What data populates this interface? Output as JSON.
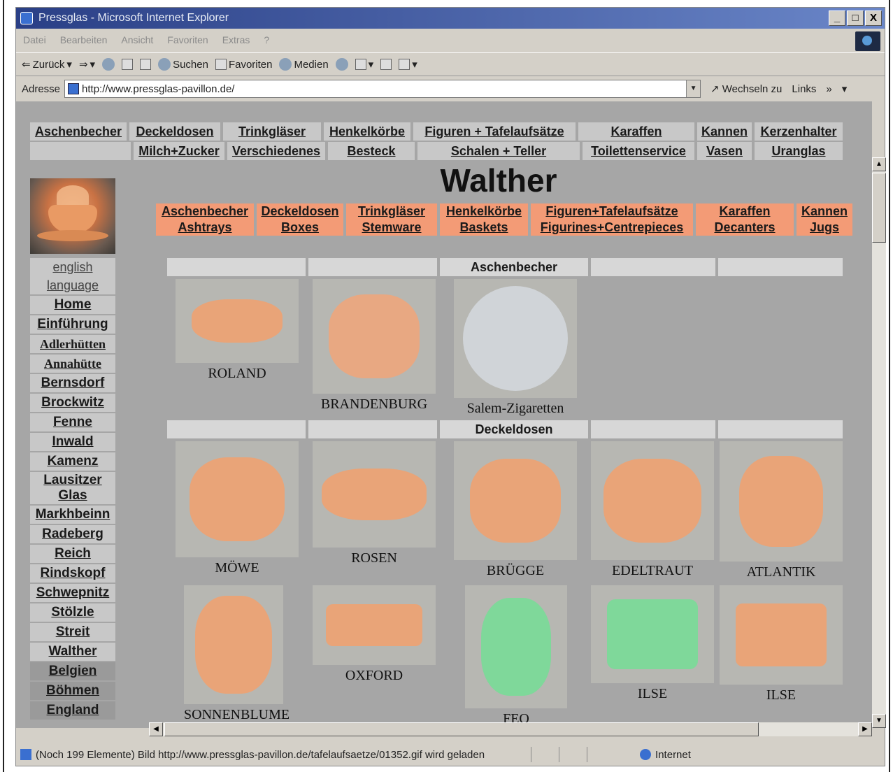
{
  "window": {
    "title": "Pressglas - Microsoft Internet Explorer",
    "minimize": "_",
    "maximize": "□",
    "close": "X"
  },
  "menu": [
    "Datei",
    "Bearbeiten",
    "Ansicht",
    "Favoriten",
    "Extras",
    "?"
  ],
  "toolbar": {
    "back": "Zurück",
    "search": "Suchen",
    "favorites": "Favoriten",
    "media": "Medien"
  },
  "address": {
    "label": "Adresse",
    "url": "http://www.pressglas-pavillon.de/",
    "go": "Wechseln zu",
    "links": "Links"
  },
  "status": {
    "text": "(Noch 199 Elemente) Bild http://www.pressglas-pavillon.de/tafelaufsaetze/01352.gif wird geladen",
    "zone": "Internet"
  },
  "topnav": {
    "row1": [
      "Aschenbecher",
      "Deckeldosen",
      "Trinkgläser",
      "Henkelkörbe",
      "Figuren + Tafelaufsätze",
      "Karaffen",
      "Kannen",
      "Kerzenhalter"
    ],
    "row2": [
      "Milch+Zucker",
      "Verschiedenes",
      "Besteck",
      "Schalen + Teller",
      "Toilettenservice",
      "Vasen",
      "Uranglas"
    ]
  },
  "sidebar": {
    "english": "english",
    "language": "language",
    "items": [
      "Home",
      "Einführung",
      "Adlerhütten",
      "Annahütte",
      "Bernsdorf",
      "Brockwitz",
      "Fenne",
      "Inwald",
      "Kamenz",
      "Lausitzer Glas",
      "Markhbeinn",
      "Radeberg",
      "Reich",
      "Rindskopf",
      "Schwepnitz",
      "Stölzle",
      "Streit",
      "Walther"
    ],
    "country_items": [
      "Belgien",
      "Böhmen",
      "England"
    ]
  },
  "page_title": "Walther",
  "orange_nav": [
    {
      "de": "Aschenbecher",
      "en": "Ashtrays"
    },
    {
      "de": "Deckeldosen",
      "en": "Boxes"
    },
    {
      "de": "Trinkgläser",
      "en": "Stemware"
    },
    {
      "de": "Henkelkörbe",
      "en": "Baskets"
    },
    {
      "de": "Figuren+Tafelaufsätze",
      "en": "Figurines+Centrepieces"
    },
    {
      "de": "Karaffen",
      "en": "Decanters"
    },
    {
      "de": "Kannen",
      "en": "Jugs"
    }
  ],
  "sections": {
    "ashtrays": "Aschenbecher",
    "boxes": "Deckeldosen"
  },
  "ashtrays": [
    "ROLAND",
    "BRANDENBURG",
    "Salem-Zigaretten"
  ],
  "boxes_row1": [
    "MÖWE",
    "ROSEN",
    "BRÜGGE",
    "EDELTRAUT",
    "ATLANTIK"
  ],
  "boxes_row2": [
    "SONNENBLUME",
    "OXFORD",
    "FEO",
    "ILSE",
    "ILSE"
  ],
  "colors": {
    "content_bg": "#a6a6a6",
    "orange_nav": "#f39b76",
    "nav_cell": "#c8c8c8",
    "pink_glass": "#e9a478",
    "green_glass": "#7fd89a",
    "clear_glass": "#d0d4d8"
  }
}
